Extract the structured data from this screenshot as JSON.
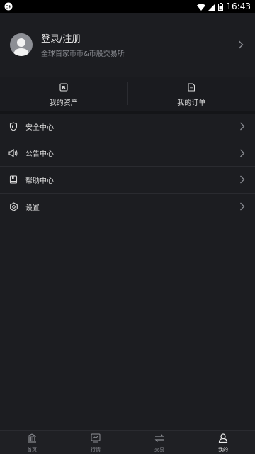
{
  "status_bar": {
    "time": "16:43"
  },
  "profile": {
    "title": "登录/注册",
    "subtitle": "全球首家币币&币股交易所"
  },
  "quick": [
    {
      "label": "我的资产",
      "icon": "bitcoin-icon"
    },
    {
      "label": "我的订单",
      "icon": "document-icon"
    }
  ],
  "menu": [
    {
      "label": "安全中心",
      "icon": "shield-icon"
    },
    {
      "label": "公告中心",
      "icon": "speaker-icon"
    },
    {
      "label": "帮助中心",
      "icon": "book-icon"
    },
    {
      "label": "设置",
      "icon": "gear-icon"
    }
  ],
  "tabbar": [
    {
      "label": "首页",
      "icon": "bank-icon"
    },
    {
      "label": "行情",
      "icon": "chart-icon"
    },
    {
      "label": "交易",
      "icon": "swap-icon"
    },
    {
      "label": "我的",
      "icon": "user-icon"
    }
  ],
  "colors": {
    "background": "#1c1d21",
    "text": "#e6e6e6",
    "muted": "#8a8c92"
  }
}
